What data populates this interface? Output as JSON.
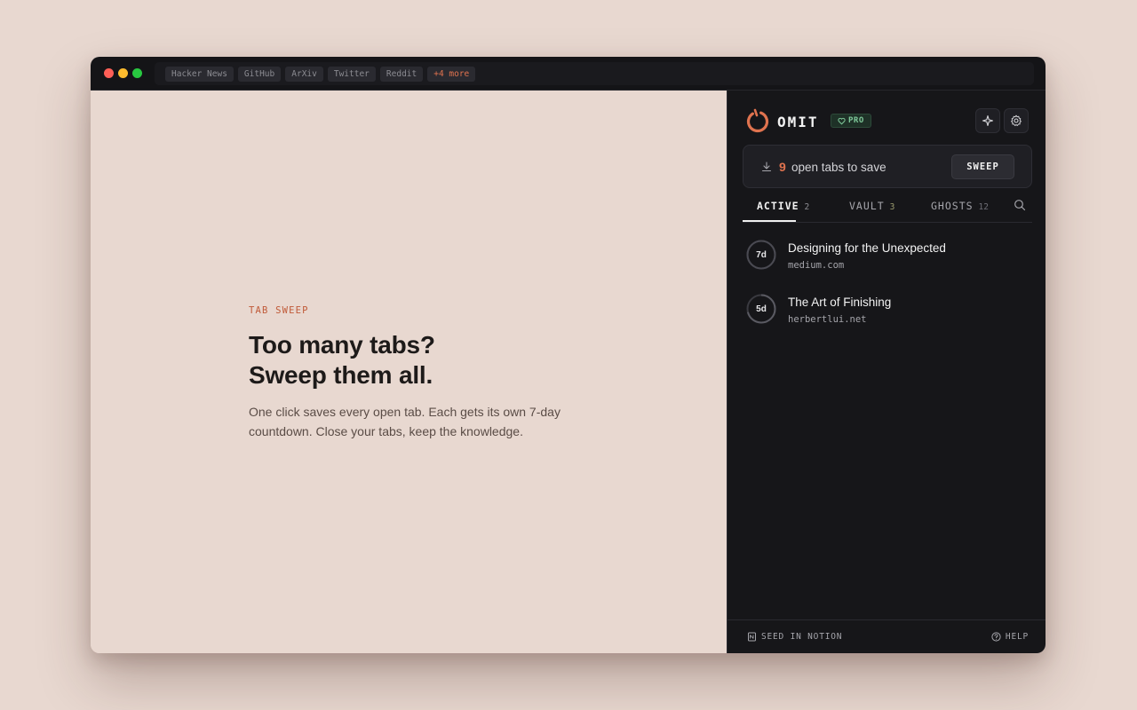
{
  "browser": {
    "tabs": [
      "Hacker News",
      "GitHub",
      "ArXiv",
      "Twitter",
      "Reddit"
    ],
    "more_label": "+4 more"
  },
  "hero": {
    "eyebrow": "TAB SWEEP",
    "headline_line1": "Too many tabs?",
    "headline_line2": "Sweep them all.",
    "body": "One click saves every open tab. Each gets its own 7-day countdown. Close your tabs, keep the knowledge."
  },
  "panel": {
    "brand": "OMIT",
    "badge": "PRO",
    "icons": {
      "assistant": "sparkle-icon",
      "settings": "gear-icon"
    },
    "save": {
      "count": "9",
      "text": "open tabs to save",
      "button": "SWEEP"
    },
    "tabs": [
      {
        "label": "ACTIVE",
        "count": "2"
      },
      {
        "label": "VAULT",
        "count": "3"
      },
      {
        "label": "GHOSTS",
        "count": "12"
      }
    ],
    "items": [
      {
        "days": "7d",
        "remaining_fraction": 1.0,
        "title": "Designing for the Unexpected",
        "url": "medium.com"
      },
      {
        "days": "5d",
        "remaining_fraction": 0.71,
        "title": "The Art of Finishing",
        "url": "herbertlui.net"
      }
    ],
    "footer": {
      "left": "SEED IN NOTION",
      "right": "HELP"
    }
  },
  "colors": {
    "accent": "#e0734f",
    "panel_bg": "#161619",
    "page_bg": "#e8d8d0",
    "pro_green": "#7fc99a"
  }
}
